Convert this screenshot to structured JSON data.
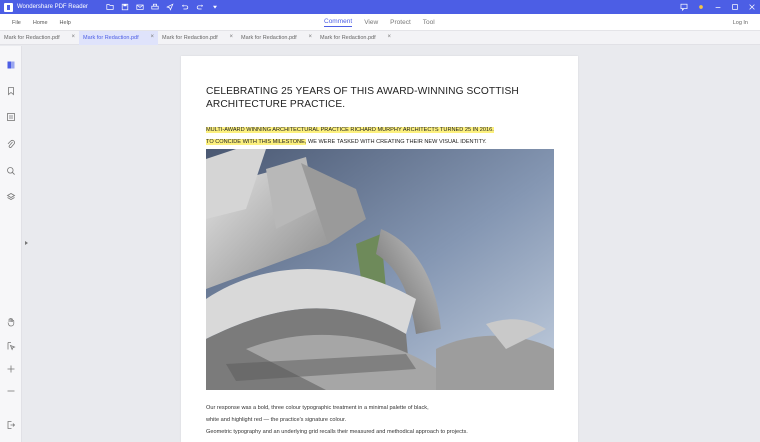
{
  "app": {
    "title": "Wondershare PDF Reader",
    "accent": "#4c5ee5",
    "toolbar_icons": [
      "folder-icon",
      "save-icon",
      "mail-icon",
      "print-icon",
      "share-icon",
      "undo-icon",
      "redo-icon",
      "dropdown-icon"
    ],
    "window_icons": [
      "chat-icon",
      "sun-icon",
      "minimize-icon",
      "maximize-icon",
      "close-icon"
    ]
  },
  "menu": {
    "left": [
      "File",
      "Home",
      "Help"
    ],
    "center": [
      "Comment",
      "View",
      "Protect",
      "Tool"
    ],
    "active": "Comment",
    "login": "Log In"
  },
  "tabs": [
    {
      "label": "Mark for Redaction.pdf",
      "active": false
    },
    {
      "label": "Mark for Redaction.pdf",
      "active": true
    },
    {
      "label": "Mark for Redaction.pdf",
      "active": false
    },
    {
      "label": "Mark for Redaction.pdf",
      "active": false
    },
    {
      "label": "Mark for Redaction.pdf",
      "active": false
    }
  ],
  "sidebar": {
    "top_icons": [
      "thumbnails-icon",
      "bookmark-icon",
      "comment-icon",
      "attachment-icon",
      "search-icon",
      "layers-icon"
    ],
    "bottom_icons": [
      "hand-icon",
      "select-icon",
      "zoom-in-icon",
      "zoom-out-icon",
      "exit-icon"
    ]
  },
  "document": {
    "title_line1": "CELEBRATING 25 YEARS OF THIS AWARD-WINNING SCOTTISH",
    "title_line2": "ARCHITECTURE PRACTICE.",
    "intro_highlight_line1": "MULTI-AWARD WINNING ARCHITECTURAL PRACTICE RICHARD MURPHY ARCHITECTS TURNED 25 IN 2016.",
    "intro_highlight_line2": "TO CONCIDE WITH THIS MILESTONE,",
    "intro_rest_line2": " WE WERE TASKED WITH CREATING THEIR NEW VISUAL IDENTITY.",
    "highlight_color": "#fcf07e",
    "body_line1": "Our response was a bold, three colour typographic treatment in a minimal palette of black,",
    "body_line2": "white and highlight red — the practice's signature colour.",
    "body_line3": "Geometric typography and an underlying grid recalls their measured and methodical approach to projects."
  }
}
